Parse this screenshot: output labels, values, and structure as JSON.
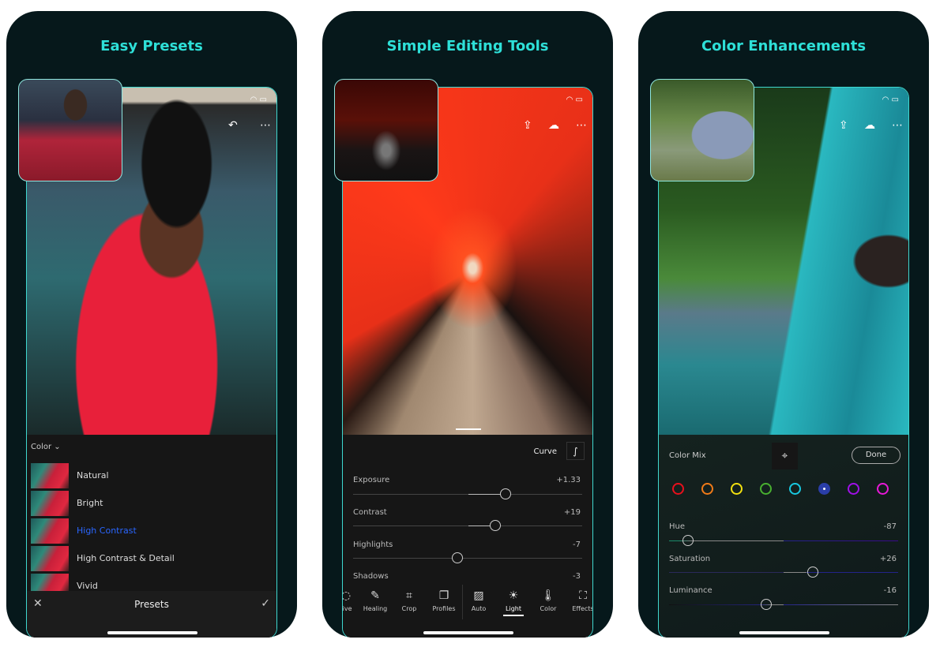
{
  "cards": [
    {
      "title": "Easy Presets",
      "preset_panel": {
        "group": "Color",
        "presets": [
          {
            "label": "Natural",
            "selected": false
          },
          {
            "label": "Bright",
            "selected": false
          },
          {
            "label": "High Contrast",
            "selected": true
          },
          {
            "label": "High Contrast & Detail",
            "selected": false
          },
          {
            "label": "Vivid",
            "selected": false
          }
        ],
        "title": "Presets",
        "selected_color": "#2a66ff"
      }
    },
    {
      "title": "Simple Editing Tools",
      "light_panel": {
        "curve_label": "Curve",
        "sliders": [
          {
            "label": "Exposure",
            "value": "+1.33"
          },
          {
            "label": "Contrast",
            "value": "+19"
          },
          {
            "label": "Highlights",
            "value": "-7"
          },
          {
            "label": "Shadows",
            "value": "-3"
          }
        ],
        "tools": [
          {
            "label": "tive",
            "icon": "selective-icon"
          },
          {
            "label": "Healing",
            "icon": "bandage-icon"
          },
          {
            "label": "Crop",
            "icon": "crop-icon"
          },
          {
            "label": "Profiles",
            "icon": "profiles-icon"
          },
          {
            "label": "Auto",
            "icon": "auto-icon"
          },
          {
            "label": "Light",
            "icon": "sun-icon",
            "active": true
          },
          {
            "label": "Color",
            "icon": "thermometer-icon"
          },
          {
            "label": "Effects",
            "icon": "effects-icon"
          }
        ]
      }
    },
    {
      "title": "Color Enhancements",
      "color_mix": {
        "label": "Color Mix",
        "done_label": "Done",
        "swatches": [
          "#e8101c",
          "#f07a18",
          "#f2e010",
          "#48b030",
          "#18c8e0",
          "#2a3ea8",
          "#a010e8",
          "#e818d8"
        ],
        "selected_swatch": 5,
        "sliders": [
          {
            "label": "Hue",
            "value": "-87"
          },
          {
            "label": "Saturation",
            "value": "+26"
          },
          {
            "label": "Luminance",
            "value": "-16"
          }
        ]
      }
    }
  ],
  "accent_color": "#2ee0d8"
}
